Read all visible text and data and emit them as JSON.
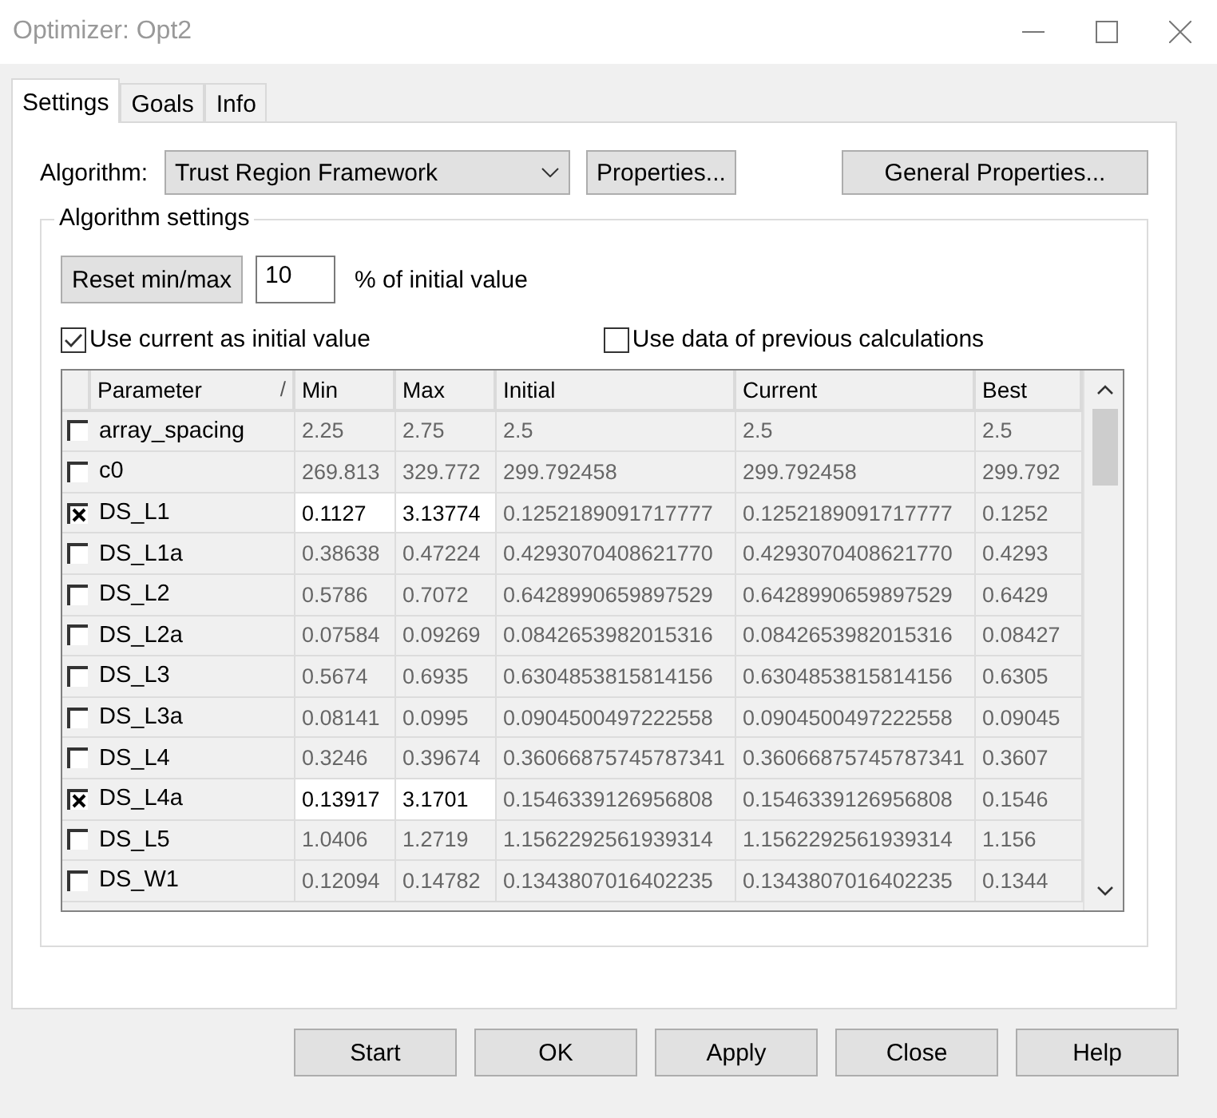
{
  "window": {
    "title": "Optimizer: Opt2"
  },
  "tabs": [
    {
      "label": "Settings",
      "selected": true
    },
    {
      "label": "Goals",
      "selected": false
    },
    {
      "label": "Info",
      "selected": false
    }
  ],
  "algorithm": {
    "label": "Algorithm:",
    "value": "Trust Region Framework",
    "properties_button": "Properties...",
    "general_properties_button": "General Properties..."
  },
  "algorithm_settings": {
    "title": "Algorithm settings",
    "reset_button": "Reset min/max",
    "percent_value": "10",
    "percent_label": "% of initial value",
    "options": [
      {
        "label": "Use current as initial value",
        "checked": true
      },
      {
        "label": "Use data of previous calculations",
        "checked": false
      }
    ]
  },
  "table": {
    "columns": [
      "Parameter",
      "Min",
      "Max",
      "Initial",
      "Current",
      "Best"
    ],
    "sort_indicator": "/",
    "rows": [
      {
        "checked": false,
        "cells": [
          "array_spacing",
          "2.25",
          "2.75",
          "2.5",
          "2.5",
          "2.5"
        ]
      },
      {
        "checked": false,
        "cells": [
          "c0",
          "269.813",
          "329.772",
          "299.792458",
          "299.792458",
          "299.792"
        ]
      },
      {
        "checked": true,
        "cells": [
          "DS_L1",
          "0.1127",
          "3.13774",
          "0.1252189091717777",
          "0.1252189091717777",
          "0.1252"
        ]
      },
      {
        "checked": false,
        "cells": [
          "DS_L1a",
          "0.38638",
          "0.47224",
          "0.4293070408621770",
          "0.4293070408621770",
          "0.4293"
        ]
      },
      {
        "checked": false,
        "cells": [
          "DS_L2",
          "0.5786",
          "0.7072",
          "0.6428990659897529",
          "0.6428990659897529",
          "0.6429"
        ]
      },
      {
        "checked": false,
        "cells": [
          "DS_L2a",
          "0.07584",
          "0.09269",
          "0.0842653982015316",
          "0.0842653982015316",
          "0.08427"
        ]
      },
      {
        "checked": false,
        "cells": [
          "DS_L3",
          "0.5674",
          "0.6935",
          "0.6304853815814156",
          "0.6304853815814156",
          "0.6305"
        ]
      },
      {
        "checked": false,
        "cells": [
          "DS_L3a",
          "0.08141",
          "0.0995",
          "0.0904500497222558",
          "0.0904500497222558",
          "0.09045"
        ]
      },
      {
        "checked": false,
        "cells": [
          "DS_L4",
          "0.3246",
          "0.39674",
          "0.36066875745787341",
          "0.36066875745787341",
          "0.3607"
        ]
      },
      {
        "checked": true,
        "cells": [
          "DS_L4a",
          "0.13917",
          "3.1701",
          "0.1546339126956808",
          "0.1546339126956808",
          "0.1546"
        ]
      },
      {
        "checked": false,
        "cells": [
          "DS_L5",
          "1.0406",
          "1.2719",
          "1.1562292561939314",
          "1.1562292561939314",
          "1.156"
        ]
      },
      {
        "checked": false,
        "cells": [
          "DS_W1",
          "0.12094",
          "0.14782",
          "0.1343807016402235",
          "0.1343807016402235",
          "0.1344"
        ]
      }
    ]
  },
  "buttons": [
    "Start",
    "OK",
    "Apply",
    "Close",
    "Help"
  ]
}
